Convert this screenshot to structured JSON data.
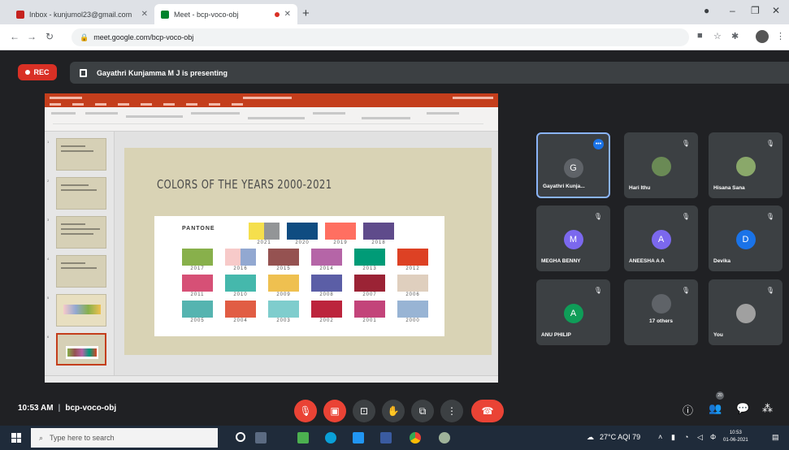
{
  "browser": {
    "tabs": [
      {
        "title": "Inbox - kunjumol23@gmail.com",
        "active": false
      },
      {
        "title": "Meet - bcp-voco-obj",
        "active": true
      }
    ],
    "address": "meet.google.com/bcp-voco-obj"
  },
  "meet": {
    "rec_label": "REC",
    "presenting_text": "Gayathri Kunjamma M J is presenting",
    "time": "10:53 AM",
    "meeting_code": "bcp-voco-obj",
    "participant_count": "20",
    "participants": [
      {
        "name": "Gayathri Kunja...",
        "initial": "G",
        "color": "#5f6368",
        "type": "letter"
      },
      {
        "name": "Hari Ithu",
        "initial": "",
        "color": "#6a8a55",
        "type": "photo"
      },
      {
        "name": "Hisana Sana",
        "initial": "",
        "color": "#8aa86a",
        "type": "photo"
      },
      {
        "name": "MEGHA BENNY",
        "initial": "M",
        "color": "#7b68ee",
        "type": "letter"
      },
      {
        "name": "ANEESHA A A",
        "initial": "A",
        "color": "#7b68ee",
        "type": "letter"
      },
      {
        "name": "Devika",
        "initial": "D",
        "color": "#1a73e8",
        "type": "letter"
      },
      {
        "name": "ANU PHILIP",
        "initial": "A",
        "color": "#0f9d58",
        "type": "letter"
      },
      {
        "name": "17 others",
        "initial": "",
        "color": "#5f6368",
        "type": "others"
      },
      {
        "name": "You",
        "initial": "",
        "color": "#a0a0a0",
        "type": "photo"
      }
    ]
  },
  "slide": {
    "title": "COLORS OF THE YEARS 2000-2021",
    "brand": "PANTONE",
    "chips": [
      {
        "year": "2021",
        "colors": [
          "#f5df4d",
          "#939597"
        ]
      },
      {
        "year": "2020",
        "colors": [
          "#0f4c81"
        ]
      },
      {
        "year": "2019",
        "colors": [
          "#ff6f61"
        ]
      },
      {
        "year": "2018",
        "colors": [
          "#5f4b8b"
        ]
      },
      {
        "year": "2017",
        "colors": [
          "#88b04b"
        ]
      },
      {
        "year": "2016",
        "colors": [
          "#f7cac9",
          "#92a8d1"
        ]
      },
      {
        "year": "2015",
        "colors": [
          "#955251"
        ]
      },
      {
        "year": "2014",
        "colors": [
          "#b565a7"
        ]
      },
      {
        "year": "2013",
        "colors": [
          "#009b77"
        ]
      },
      {
        "year": "2012",
        "colors": [
          "#dd4124"
        ]
      },
      {
        "year": "2011",
        "colors": [
          "#d65076"
        ]
      },
      {
        "year": "2010",
        "colors": [
          "#45b8ac"
        ]
      },
      {
        "year": "2009",
        "colors": [
          "#efc050"
        ]
      },
      {
        "year": "2008",
        "colors": [
          "#5b5ea6"
        ]
      },
      {
        "year": "2007",
        "colors": [
          "#9b2335"
        ]
      },
      {
        "year": "2006",
        "colors": [
          "#dfcfbe"
        ]
      },
      {
        "year": "2005",
        "colors": [
          "#55b4b0"
        ]
      },
      {
        "year": "2004",
        "colors": [
          "#e15d44"
        ]
      },
      {
        "year": "2003",
        "colors": [
          "#7fcdcd"
        ]
      },
      {
        "year": "2002",
        "colors": [
          "#bc243c"
        ]
      },
      {
        "year": "2001",
        "colors": [
          "#c3447a"
        ]
      },
      {
        "year": "2000",
        "colors": [
          "#98b4d4"
        ]
      }
    ]
  },
  "taskbar": {
    "search_placeholder": "Type here to search",
    "weather": "27°C AQI 79",
    "clock_time": "10:53",
    "clock_date": "01-06-2021"
  }
}
